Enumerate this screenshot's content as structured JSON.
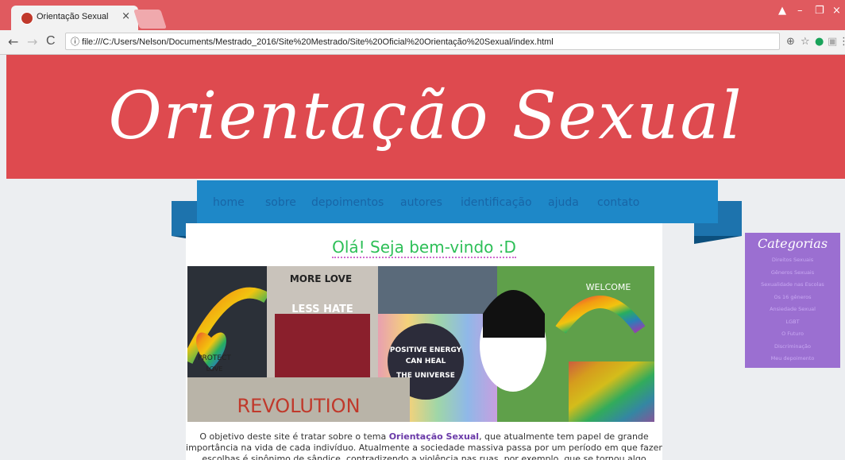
{
  "browser": {
    "tab_title": "Orientação Sexual",
    "tab_close": "×",
    "url": "file:///C:/Users/Nelson/Documents/Mestrado_2016/Site%20Mestrado/Site%20Oficial%20Orientação%20Sexual/index.html",
    "back": "←",
    "forward": "→",
    "reload": "C",
    "info": "ⓘ",
    "zoom": "⊕",
    "star": "☆",
    "menu": "⋮",
    "win_user": "▲",
    "win_min": "–",
    "win_restore": "❐",
    "win_close": "×"
  },
  "site": {
    "title": "Orientação Sexual",
    "nav": [
      "home",
      "sobre",
      "depoimentos",
      "autores",
      "identificação",
      "ajuda",
      "contato"
    ],
    "welcome": "Olá! Seja bem-vindo :D",
    "intro_pre": "O objetivo deste site é tratar sobre o tema ",
    "intro_bold": "Orientação Sexual",
    "intro_post": ", que atualmente tem papel de grande importância na vida de cada indivíduo. Atualmente a sociedade massiva passa por um período em que fazer escolhas é sinônimo de sândice, contradizendo a violência nas ruas, por exemplo, que se tornou algo normal"
  },
  "collage": {
    "texts": [
      "MORE LOVE",
      "LESS HATE",
      "PROTECT",
      "LOVE",
      "POSITIVE ENERGY",
      "CAN HEAL",
      "THE UNIVERSE",
      "REVOLUTION",
      "WELCOME"
    ]
  },
  "sidebar": {
    "title": "Categorias",
    "items": [
      "Direitos Sexuais",
      "Gêneros Sexuais",
      "Sexualidade nas Escolas",
      "Os 16 gêneros",
      "Ansiedade Sexual",
      "LGBT",
      "O Futuro",
      "Discriminação",
      "Meu depoimento"
    ]
  }
}
